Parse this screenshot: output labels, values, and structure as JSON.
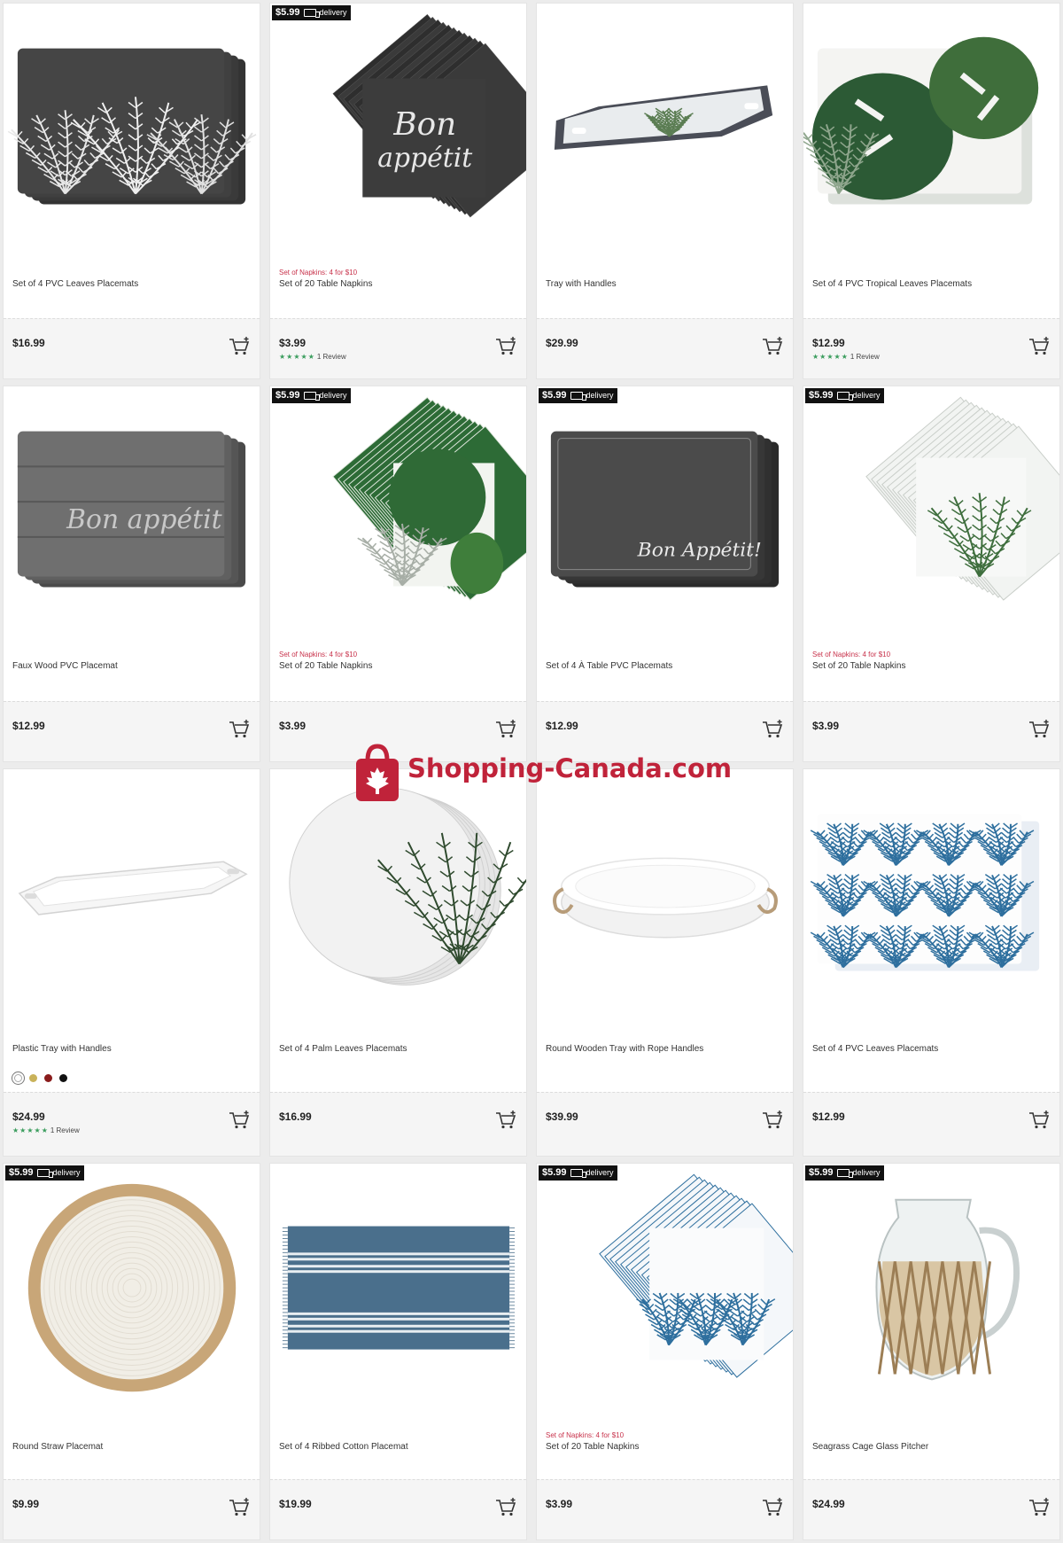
{
  "watermark": {
    "text": "Shopping-Canada.com",
    "color": "#c0233a"
  },
  "products": [
    {
      "id": 0,
      "name": "Set of 4 PVC Leaves Placemats",
      "price": "$16.99",
      "promo": "",
      "badge": false,
      "rating": 0,
      "reviews": "",
      "image": "dark-palm-placemats",
      "swatches": []
    },
    {
      "id": 1,
      "name": "Set of 20 Table Napkins",
      "price": "$3.99",
      "promo": "Set of Napkins: 4 for $10",
      "badge": true,
      "rating": 5,
      "reviews": "1 Review",
      "image": "bon-appetit-napkins",
      "swatches": []
    },
    {
      "id": 2,
      "name": "Tray with Handles",
      "price": "$29.99",
      "promo": "",
      "badge": false,
      "rating": 0,
      "reviews": "",
      "image": "dark-tray",
      "swatches": []
    },
    {
      "id": 3,
      "name": "Set of 4 PVC Tropical Leaves Placemats",
      "price": "$12.99",
      "promo": "",
      "badge": false,
      "rating": 5,
      "reviews": "1 Review",
      "image": "monstera-placemats",
      "swatches": []
    },
    {
      "id": 4,
      "name": "Faux Wood PVC Placemat",
      "price": "$12.99",
      "promo": "",
      "badge": false,
      "rating": 0,
      "reviews": "",
      "image": "faux-wood-placemats",
      "swatches": []
    },
    {
      "id": 5,
      "name": "Set of 20 Table Napkins",
      "price": "$3.99",
      "promo": "Set of Napkins: 4 for $10",
      "badge": true,
      "rating": 0,
      "reviews": "",
      "image": "monstera-napkins",
      "swatches": []
    },
    {
      "id": 6,
      "name": "Set of 4 À Table PVC Placemats",
      "price": "$12.99",
      "promo": "",
      "badge": true,
      "rating": 0,
      "reviews": "",
      "image": "bon-appetit-placemats",
      "swatches": []
    },
    {
      "id": 7,
      "name": "Set of 20 Table Napkins",
      "price": "$3.99",
      "promo": "Set of Napkins: 4 for $10",
      "badge": true,
      "rating": 0,
      "reviews": "",
      "image": "palm-napkins",
      "swatches": []
    },
    {
      "id": 8,
      "name": "Plastic Tray with Handles",
      "price": "$24.99",
      "promo": "",
      "badge": false,
      "rating": 5,
      "reviews": "1 Review",
      "image": "white-tray",
      "swatches": [
        "#ffffff",
        "#c9b25a",
        "#8a1c1c",
        "#111111"
      ]
    },
    {
      "id": 9,
      "name": "Set of 4 Palm Leaves Placemats",
      "price": "$16.99",
      "promo": "",
      "badge": false,
      "rating": 0,
      "reviews": "",
      "image": "round-palm-placemats",
      "swatches": []
    },
    {
      "id": 10,
      "name": "Round Wooden Tray with Rope Handles",
      "price": "$39.99",
      "promo": "",
      "badge": false,
      "rating": 0,
      "reviews": "",
      "image": "round-white-tray",
      "swatches": []
    },
    {
      "id": 11,
      "name": "Set of 4 PVC Leaves Placemats",
      "price": "$12.99",
      "promo": "",
      "badge": false,
      "rating": 0,
      "reviews": "",
      "image": "blue-palm-placemats",
      "swatches": []
    },
    {
      "id": 12,
      "name": "Round Straw Placemat",
      "price": "$9.99",
      "promo": "",
      "badge": true,
      "rating": 0,
      "reviews": "",
      "image": "straw-placemat",
      "swatches": []
    },
    {
      "id": 13,
      "name": "Set of 4 Ribbed Cotton Placemat",
      "price": "$19.99",
      "promo": "",
      "badge": false,
      "rating": 0,
      "reviews": "",
      "image": "blue-cotton-placemat",
      "swatches": []
    },
    {
      "id": 14,
      "name": "Set of 20 Table Napkins",
      "price": "$3.99",
      "promo": "Set of Napkins: 4 for $10",
      "badge": true,
      "rating": 0,
      "reviews": "",
      "image": "blue-palm-napkins",
      "swatches": []
    },
    {
      "id": 15,
      "name": "Seagrass Cage Glass Pitcher",
      "price": "$24.99",
      "promo": "",
      "badge": true,
      "rating": 0,
      "reviews": "",
      "image": "glass-pitcher",
      "swatches": []
    }
  ],
  "badge": {
    "price": "$5.99",
    "label": "delivery"
  },
  "image_text": {
    "bon_appetit_1": "Bon",
    "bon_appetit_2": "appétit",
    "bon_appetit_faux": "Bon appétit",
    "bon_appetit_board": "Bon Appétit!"
  }
}
